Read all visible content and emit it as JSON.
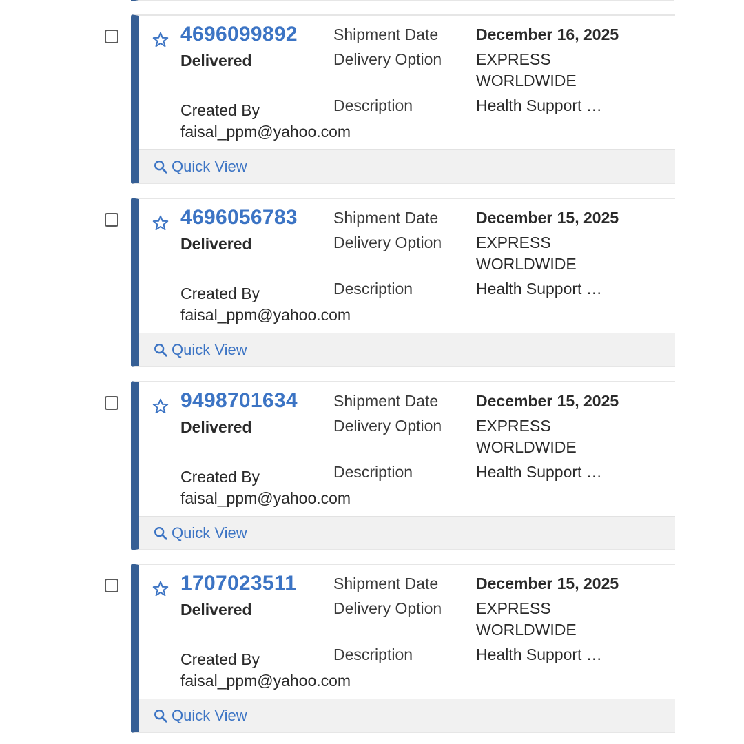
{
  "labels": {
    "shipment_date": "Shipment Date",
    "delivery_option": "Delivery Option",
    "description": "Description",
    "created_by": "Created By",
    "quick_view": "Quick View"
  },
  "colors": {
    "accent": "#3c74c4",
    "card_bar": "#365f95",
    "footer_bg": "#f1f1f1"
  },
  "icons": {
    "favorite": "star-icon",
    "quick_view": "search-icon",
    "select": "checkbox"
  },
  "shipments": [
    {
      "tracking": "4696099892",
      "status": "Delivered",
      "shipment_date": "December 16, 2025",
      "delivery_option_line1": "EXPRESS",
      "delivery_option_line2": "WORLDWIDE",
      "description": "Health Support …",
      "created_by": "faisal_ppm@yahoo.com"
    },
    {
      "tracking": "4696056783",
      "status": "Delivered",
      "shipment_date": "December 15, 2025",
      "delivery_option_line1": "EXPRESS",
      "delivery_option_line2": "WORLDWIDE",
      "description": "Health Support …",
      "created_by": "faisal_ppm@yahoo.com"
    },
    {
      "tracking": "9498701634",
      "status": "Delivered",
      "shipment_date": "December 15, 2025",
      "delivery_option_line1": "EXPRESS",
      "delivery_option_line2": "WORLDWIDE",
      "description": "Health Support …",
      "created_by": "faisal_ppm@yahoo.com"
    },
    {
      "tracking": "1707023511",
      "status": "Delivered",
      "shipment_date": "December 15, 2025",
      "delivery_option_line1": "EXPRESS",
      "delivery_option_line2": "WORLDWIDE",
      "description": "Health Support …",
      "created_by": "faisal_ppm@yahoo.com"
    }
  ]
}
